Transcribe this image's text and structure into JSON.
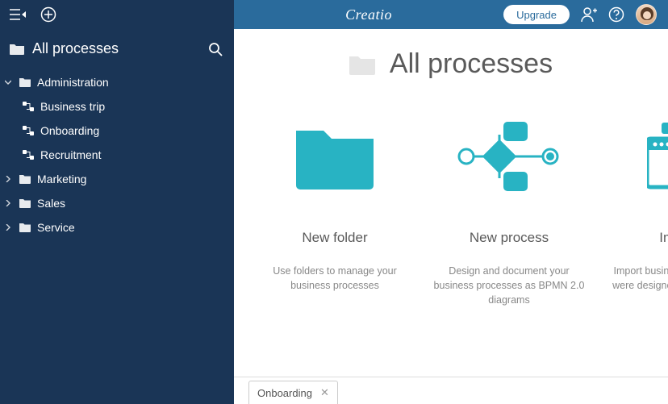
{
  "brand": "Creatio",
  "topbar": {
    "upgrade": "Upgrade"
  },
  "sidebar": {
    "title": "All processes",
    "nodes": [
      {
        "label": "Administration",
        "expanded": true,
        "children": [
          {
            "label": "Business trip"
          },
          {
            "label": "Onboarding"
          },
          {
            "label": "Recruitment"
          }
        ]
      },
      {
        "label": "Marketing",
        "expanded": false
      },
      {
        "label": "Sales",
        "expanded": false
      },
      {
        "label": "Service",
        "expanded": false
      }
    ]
  },
  "page": {
    "title": "All processes"
  },
  "cards": [
    {
      "title": "New folder",
      "desc": "Use folders to manage your business processes"
    },
    {
      "title": "New process",
      "desc": "Design and document your business processes as BPMN 2.0 diagrams"
    },
    {
      "title": "Import *",
      "desc": "Import business processes that were designed in other systems"
    }
  ],
  "tabs": [
    {
      "label": "Onboarding"
    }
  ],
  "colors": {
    "accent": "#28b3c3",
    "sidebar": "#1a3556",
    "topbar": "#2a6b9c"
  }
}
